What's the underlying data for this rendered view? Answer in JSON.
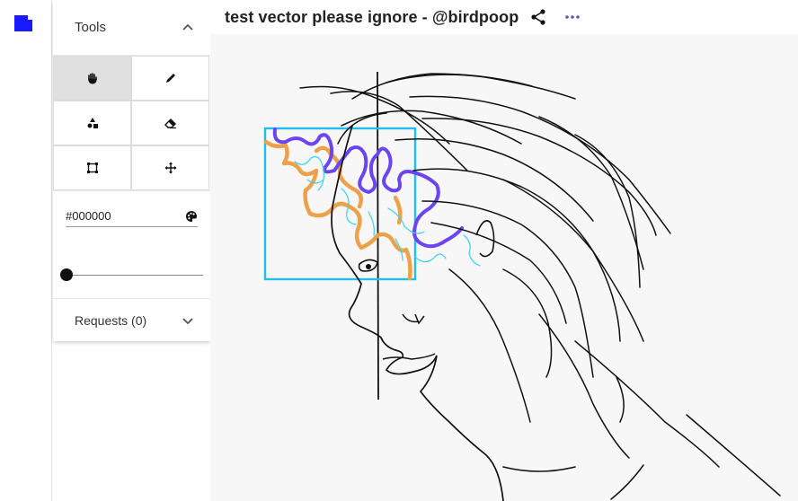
{
  "app": {
    "document_icon": "document-icon"
  },
  "tools_panel": {
    "title": "Tools",
    "collapse_icon": "chevron-up-icon",
    "tools": [
      {
        "name": "hand",
        "icon": "hand-icon",
        "active": true
      },
      {
        "name": "pen",
        "icon": "pen-icon",
        "active": false
      },
      {
        "name": "shapes",
        "icon": "shapes-icon",
        "active": false
      },
      {
        "name": "eraser",
        "icon": "eraser-icon",
        "active": false
      },
      {
        "name": "select",
        "icon": "select-box-icon",
        "active": false
      },
      {
        "name": "move",
        "icon": "move-icon",
        "active": false
      }
    ],
    "color_value": "#000000",
    "color_icon": "palette-icon",
    "brush_size": 0
  },
  "requests": {
    "label": "Requests (0)",
    "expand_icon": "chevron-down-icon"
  },
  "header": {
    "title": "test vector please ignore - @birdpoop",
    "share_icon": "share-icon",
    "more_icon": "more-horizontal-icon"
  },
  "colors": {
    "brand": "#1a1aff",
    "selection": "#22bdf0",
    "stroke_purple": "#6b45f0",
    "stroke_orange": "#eba24a",
    "stroke_cyan": "#3ad0f5",
    "ink": "#111111"
  }
}
